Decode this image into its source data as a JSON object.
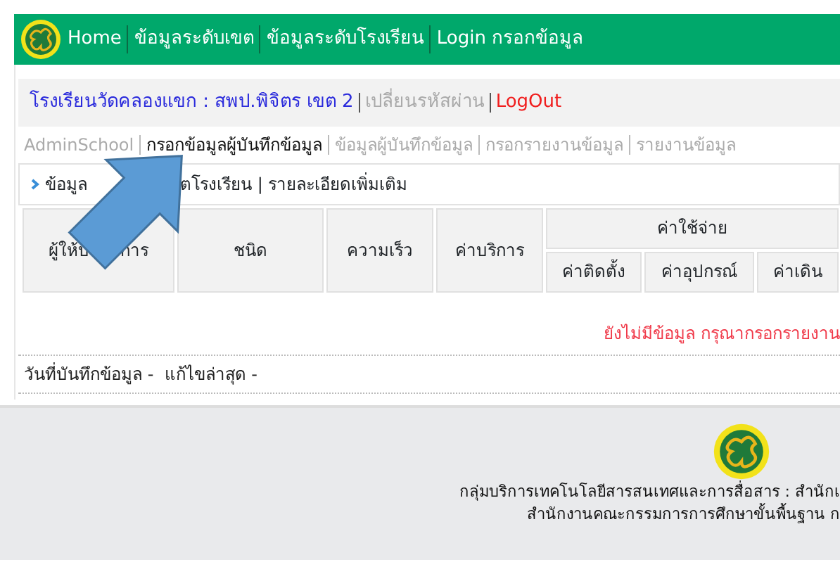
{
  "navbar": {
    "links": [
      "Home",
      "ข้อมูลระดับเขต",
      "ข้อมูลระดับโรงเรียน",
      "Login กรอกข้อมูล"
    ]
  },
  "user_bar": {
    "school": "โรงเรียนวัดคลองแขก : สพป.พิจิตร เขต 2",
    "change_password": "เปลี่ยนรหัสผ่าน",
    "logout": "LogOut"
  },
  "tabs": [
    {
      "label": "AdminSchool",
      "selected": false
    },
    {
      "label": "กรอกข้อมูลผู้บันทึกข้อมูล",
      "selected": true
    },
    {
      "label": "ข้อมูลผู้บันทึกข้อมูล",
      "selected": false
    },
    {
      "label": "กรอกรายงานข้อมูล",
      "selected": false
    },
    {
      "label": "รายงานข้อมูล",
      "selected": false
    }
  ],
  "panel": {
    "heading_start": "ข้อมูล",
    "heading_end": "ตโรงเรียน | รายละเอียดเพิ่มเติม"
  },
  "table": {
    "columns": [
      {
        "start": "ผู้ให้บ",
        "end": "การ"
      },
      {
        "start": "ชนิด"
      },
      {
        "start": "ความเร็ว"
      },
      {
        "start": "ค่าบริการ"
      }
    ],
    "group": "ค่าใช้จ่าย",
    "sub_columns": [
      "ค่าติดตั้ง",
      "ค่าอุปกรณ์",
      "ค่าเดิน"
    ]
  },
  "empty_message": "ยังไม่มีข้อมูล กรุณากรอกรายงาน",
  "record_info": "วันที่บันทึกข้อมูล -  แก้ไขล่าสุด -",
  "footer": {
    "lines": [
      "กลุ่มบริการเทคโนโลยีสารสนเทศและการสื่อสาร : สำนักเ",
      "สำนักงานคณะกรรมการการศึกษาขั้นพื้นฐาน ก"
    ]
  }
}
